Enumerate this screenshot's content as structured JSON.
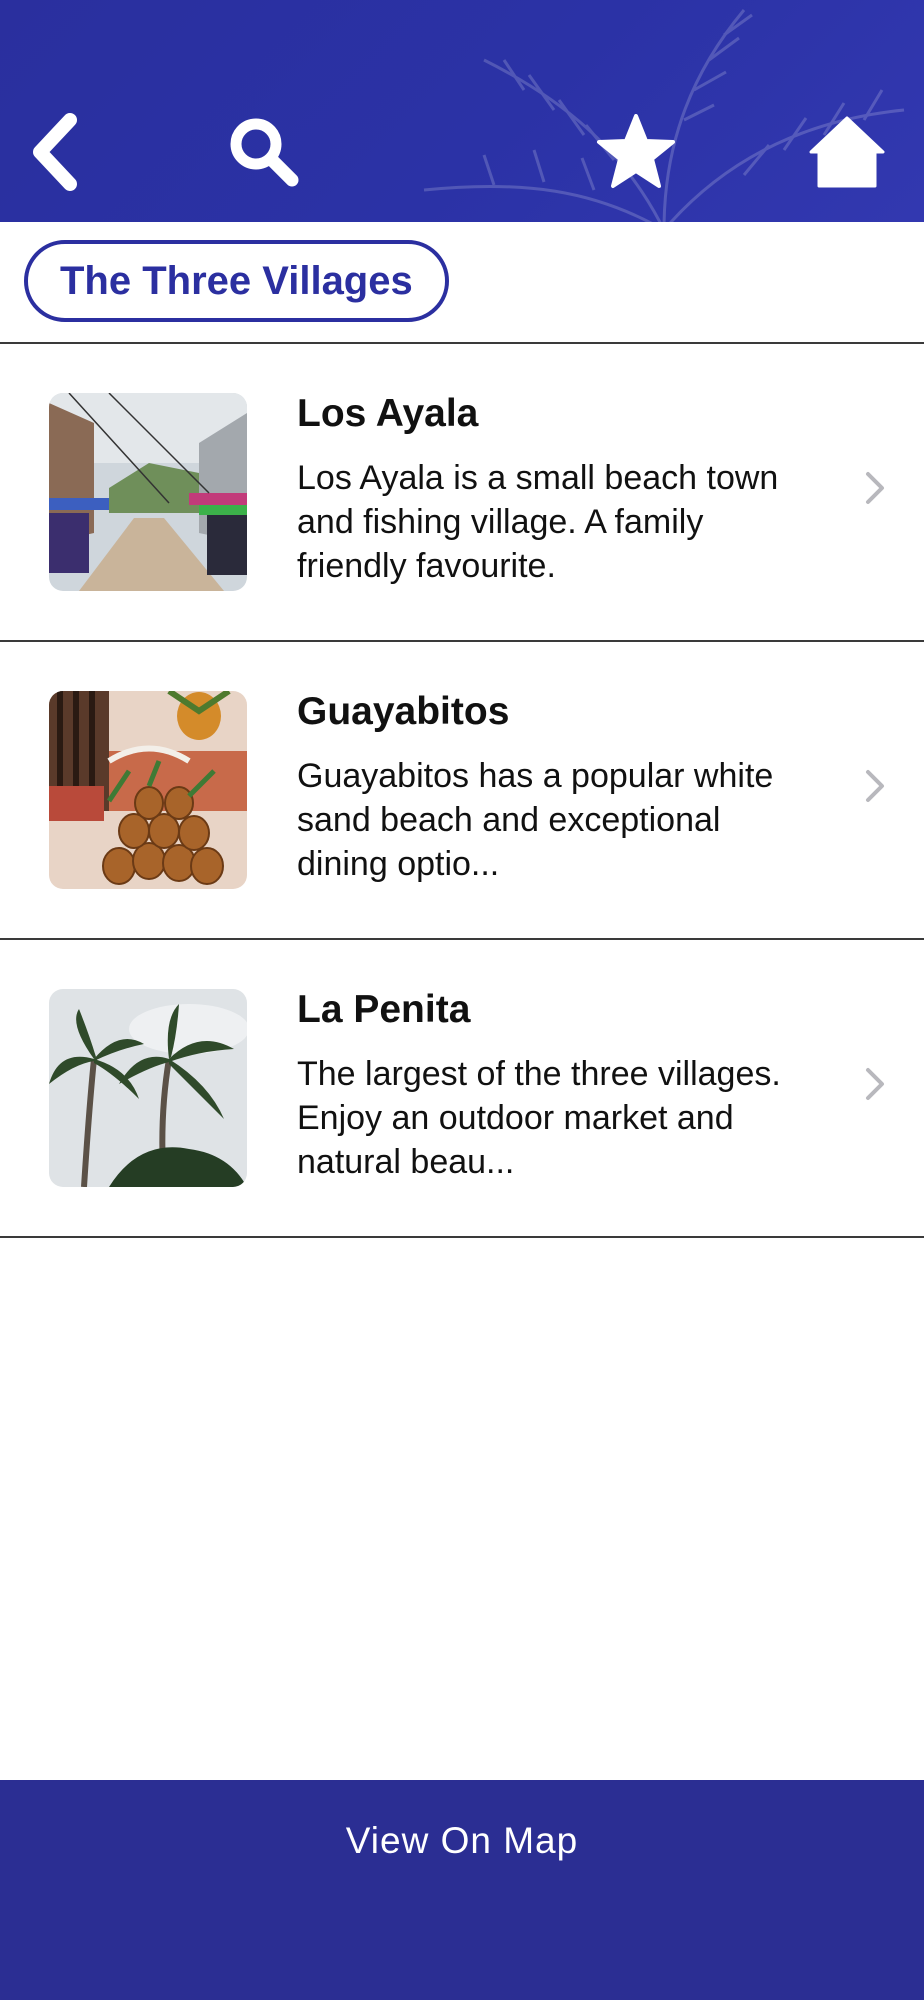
{
  "header": {
    "icons": [
      "back-icon",
      "search-icon",
      "star-icon",
      "home-icon"
    ]
  },
  "page": {
    "title": "The Three Villages"
  },
  "villages": [
    {
      "name": "Los Ayala",
      "description": "Los Ayala is a small beach town and fishing village. A family friendly favourite."
    },
    {
      "name": "Guayabitos",
      "description": "Guayabitos has a popular white sand beach and exceptional dining optio..."
    },
    {
      "name": "La Penita",
      "description": "The largest of the three villages. Enjoy an outdoor market and natural beau..."
    }
  ],
  "footer": {
    "button_label": "View On Map"
  },
  "colors": {
    "brand": "#2b2fa0",
    "footer": "#2b2e93"
  }
}
